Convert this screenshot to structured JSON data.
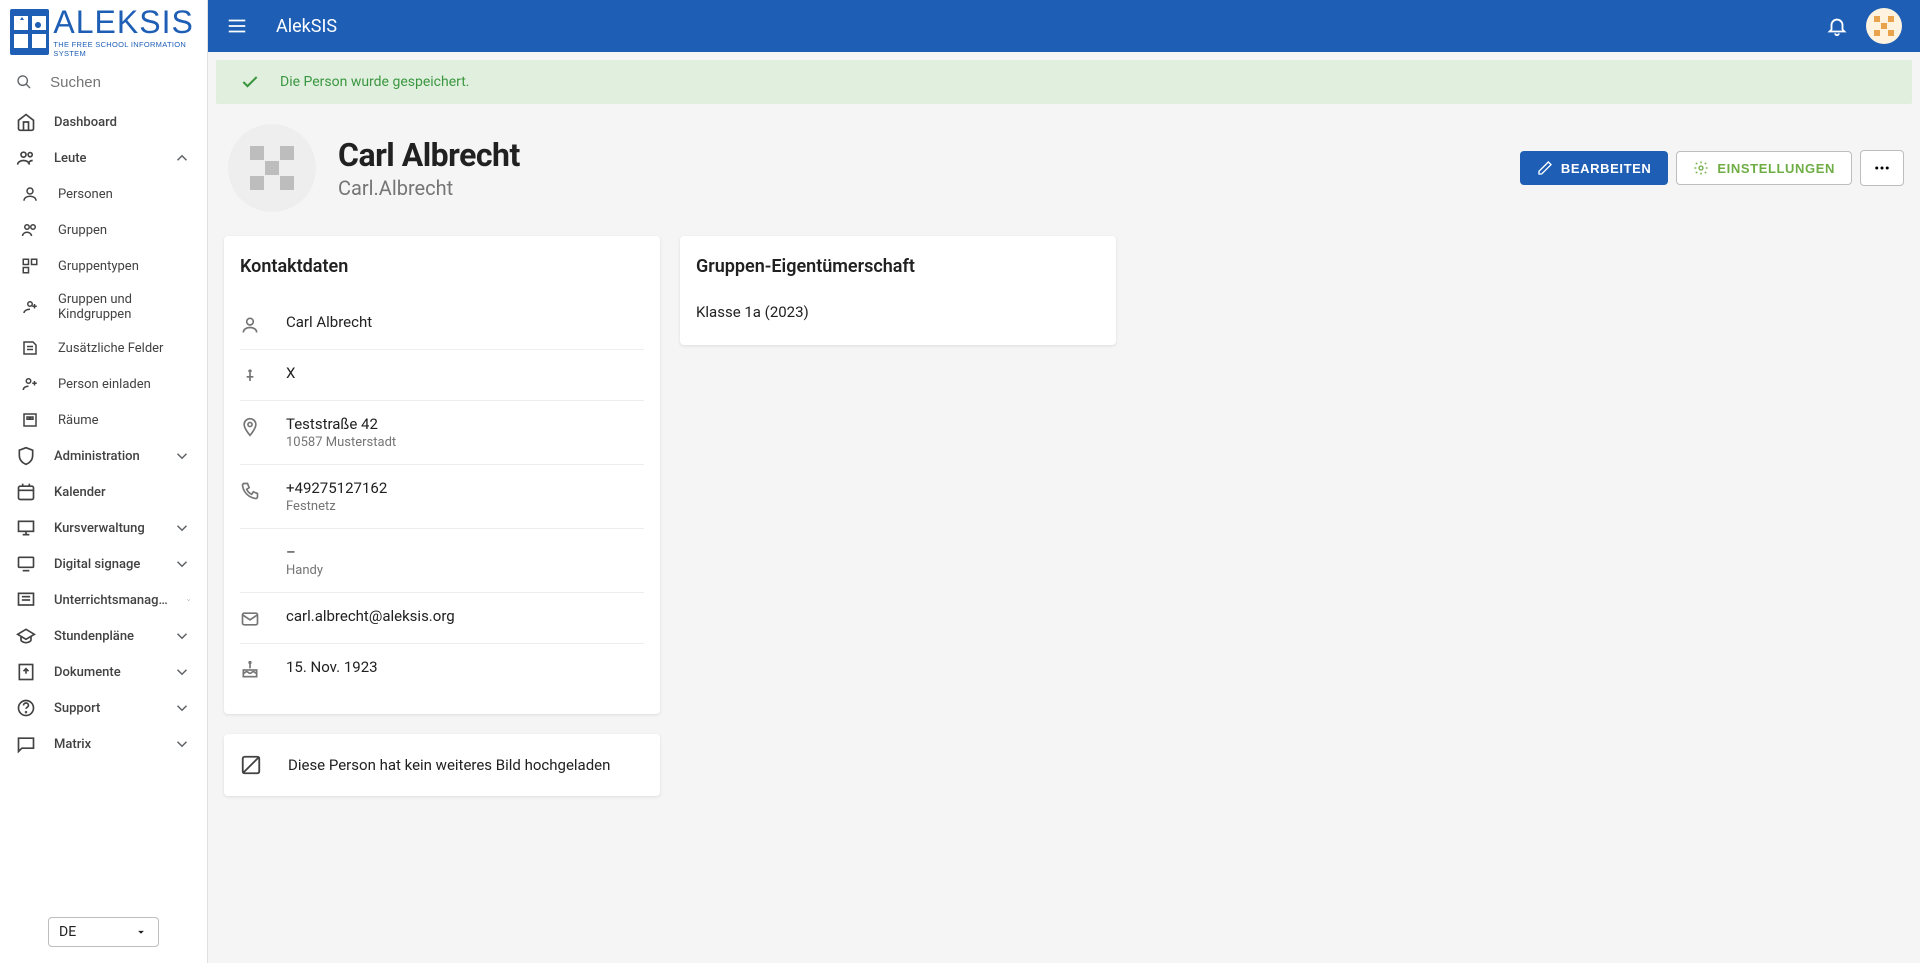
{
  "appTitle": "AlekSIS",
  "logo": {
    "main": "ALEKSIS",
    "sub": "THE FREE SCHOOL INFORMATION SYSTEM"
  },
  "search": {
    "placeholder": "Suchen"
  },
  "nav": {
    "dashboard": "Dashboard",
    "people": "Leute",
    "persons": "Personen",
    "groups": "Gruppen",
    "grouptypes": "Gruppentypen",
    "groups_child": "Gruppen und Kindgruppen",
    "extra_fields": "Zusätzliche Felder",
    "invite": "Person einladen",
    "rooms": "Räume",
    "admin": "Administration",
    "calendar": "Kalender",
    "course_mgmt": "Kursverwaltung",
    "digital_signage": "Digital signage",
    "lesson_mgmt": "Unterrichtsmanag…",
    "timetables": "Stundenpläne",
    "documents": "Dokumente",
    "support": "Support",
    "matrix": "Matrix"
  },
  "lang": "DE",
  "alert": {
    "message": "Die Person wurde gespeichert."
  },
  "person": {
    "full_name": "Carl Albrecht",
    "username": "Carl.Albrecht"
  },
  "actions": {
    "edit": "BEARBEITEN",
    "settings": "EINSTELLUNGEN"
  },
  "contact": {
    "title": "Kontaktdaten",
    "name": "Carl Albrecht",
    "sex": "X",
    "street": "Teststraße 42",
    "city": "10587 Musterstadt",
    "phone": "+49275127162",
    "phone_label": "Festnetz",
    "mobile": "–",
    "mobile_label": "Handy",
    "email": "carl.albrecht@aleksis.org",
    "birthday": "15. Nov. 1923"
  },
  "group_ownership": {
    "title": "Gruppen-Eigentümerschaft",
    "items": [
      "Klasse 1a (2023)"
    ]
  },
  "no_image_msg": "Diese Person hat kein weiteres Bild hochgeladen"
}
